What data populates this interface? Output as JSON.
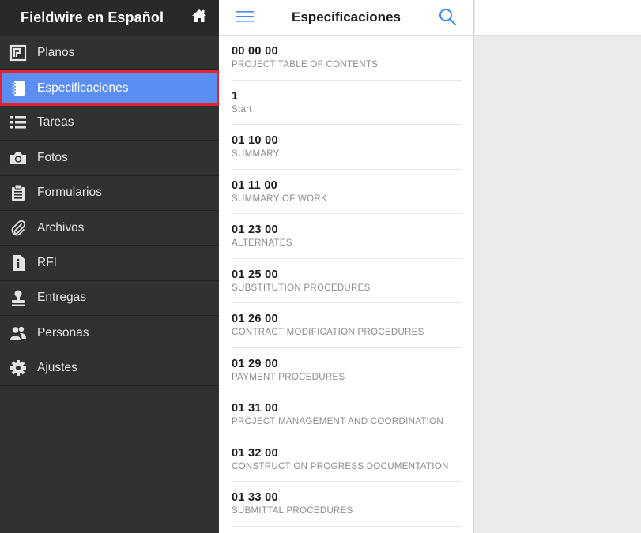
{
  "sidebar": {
    "title": "Fieldwire en Español",
    "items": [
      {
        "label": "Planos",
        "icon": "plans-icon"
      },
      {
        "label": "Especificaciones",
        "icon": "specifications-icon",
        "active": true
      },
      {
        "label": "Tareas",
        "icon": "tasks-list-icon"
      },
      {
        "label": "Fotos",
        "icon": "camera-icon"
      },
      {
        "label": "Formularios",
        "icon": "clipboard-icon"
      },
      {
        "label": "Archivos",
        "icon": "paperclip-icon"
      },
      {
        "label": "RFI",
        "icon": "rfi-document-icon"
      },
      {
        "label": "Entregas",
        "icon": "stamp-icon"
      },
      {
        "label": "Personas",
        "icon": "people-icon"
      },
      {
        "label": "Ajustes",
        "icon": "gear-icon"
      }
    ]
  },
  "specs_panel": {
    "title": "Especificaciones",
    "items": [
      {
        "number": "00 00 00",
        "name": "PROJECT TABLE OF CONTENTS"
      },
      {
        "number": "1",
        "name": "Start"
      },
      {
        "number": "01 10 00",
        "name": "SUMMARY"
      },
      {
        "number": "01 11 00",
        "name": "SUMMARY OF WORK"
      },
      {
        "number": "01 23 00",
        "name": "ALTERNATES"
      },
      {
        "number": "01 25 00",
        "name": "SUBSTITUTION PROCEDURES"
      },
      {
        "number": "01 26 00",
        "name": "CONTRACT MODIFICATION PROCEDURES"
      },
      {
        "number": "01 29 00",
        "name": "PAYMENT PROCEDURES"
      },
      {
        "number": "01 31 00",
        "name": "PROJECT MANAGEMENT AND COORDINATION"
      },
      {
        "number": "01 32 00",
        "name": "CONSTRUCTION PROGRESS DOCUMENTATION"
      },
      {
        "number": "01 33 00",
        "name": "SUBMITTAL PROCEDURES"
      }
    ]
  },
  "colors": {
    "sidebar_bg": "#2f3133",
    "active_bg": "#5b8ef4",
    "highlight_border": "#e8202f",
    "accent_blue": "#3d8ef0"
  }
}
